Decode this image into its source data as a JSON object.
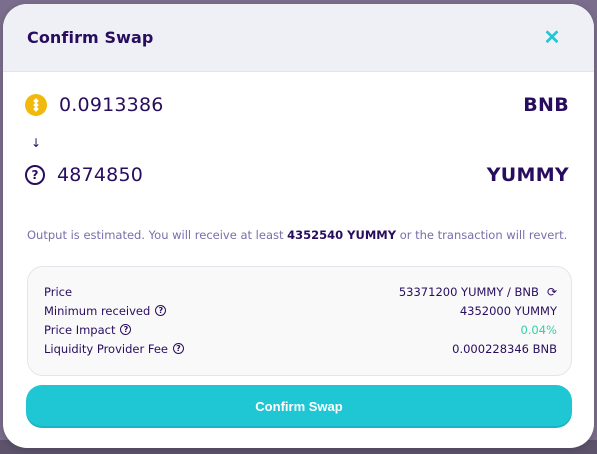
{
  "modal": {
    "title": "Confirm Swap",
    "close_symbol": "✕"
  },
  "swap": {
    "input": {
      "amount": "0.0913386",
      "symbol": "BNB",
      "icon": "bnb-token-icon"
    },
    "output": {
      "amount": "4874850",
      "symbol": "YUMMY",
      "icon": "unknown-token-icon"
    },
    "arrow": "↓"
  },
  "note": {
    "prefix": "Output is estimated. You will receive at least ",
    "min_amount": "4352540 YUMMY",
    "suffix": " or the transaction will revert."
  },
  "details": {
    "price": {
      "label": "Price",
      "value": "53371200 YUMMY / BNB"
    },
    "minimum_received": {
      "label": "Minimum received",
      "value": "4352000 YUMMY"
    },
    "price_impact": {
      "label": "Price Impact",
      "value": "0.04%"
    },
    "lp_fee": {
      "label": "Liquidity Provider Fee",
      "value": "0.000228346 BNB"
    }
  },
  "confirm_button": {
    "label": "Confirm Swap"
  },
  "colors": {
    "primary": "#1fc7d4",
    "text": "#280d5f",
    "success": "#31d0aa",
    "bnb": "#f0b90b"
  }
}
